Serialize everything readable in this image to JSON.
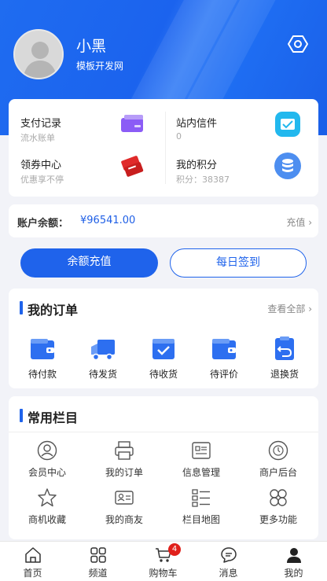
{
  "profile": {
    "name": "小黑",
    "subtitle": "模板开发网"
  },
  "quick": [
    {
      "title": "支付记录",
      "sub": "流水账单",
      "icon": "card-icon",
      "color": "#8b5cf6"
    },
    {
      "title": "站内信件",
      "sub": "0",
      "icon": "message-icon",
      "color": "#22b8ee"
    },
    {
      "title": "领券中心",
      "sub": "优惠享不停",
      "icon": "coupon-icon",
      "color": "#e02a2a"
    },
    {
      "title": "我的积分",
      "sub": "积分：38387",
      "icon": "coins-icon",
      "color": "#4d8ef0"
    }
  ],
  "balance": {
    "label": "账户余额：",
    "value": "¥96541.00",
    "recharge": "充值"
  },
  "buttons": {
    "recharge": "余额充值",
    "checkin": "每日签到"
  },
  "orders": {
    "title": "我的订单",
    "view_all": "查看全部",
    "items": [
      {
        "label": "待付款",
        "icon": "wallet-icon"
      },
      {
        "label": "待发货",
        "icon": "truck-icon"
      },
      {
        "label": "待收货",
        "icon": "box-check-icon"
      },
      {
        "label": "待评价",
        "icon": "wallet-icon"
      },
      {
        "label": "退换货",
        "icon": "return-icon"
      }
    ]
  },
  "columns": {
    "title": "常用栏目",
    "items": [
      {
        "label": "会员中心",
        "icon": "user-circle-icon"
      },
      {
        "label": "我的订单",
        "icon": "printer-icon"
      },
      {
        "label": "信息管理",
        "icon": "info-card-icon"
      },
      {
        "label": "商户后台",
        "icon": "clock-icon"
      },
      {
        "label": "商机收藏",
        "icon": "star-icon"
      },
      {
        "label": "我的商友",
        "icon": "id-card-icon"
      },
      {
        "label": "栏目地图",
        "icon": "list-icon"
      },
      {
        "label": "更多功能",
        "icon": "clover-icon"
      }
    ]
  },
  "tabbar": {
    "items": [
      {
        "label": "首页",
        "icon": "home-icon"
      },
      {
        "label": "频道",
        "icon": "grid-icon"
      },
      {
        "label": "购物车",
        "icon": "cart-icon",
        "badge": "4"
      },
      {
        "label": "消息",
        "icon": "chat-icon"
      },
      {
        "label": "我的",
        "icon": "user-icon"
      }
    ]
  },
  "colors": {
    "primary": "#1f63eb",
    "badge": "#e0201b"
  }
}
